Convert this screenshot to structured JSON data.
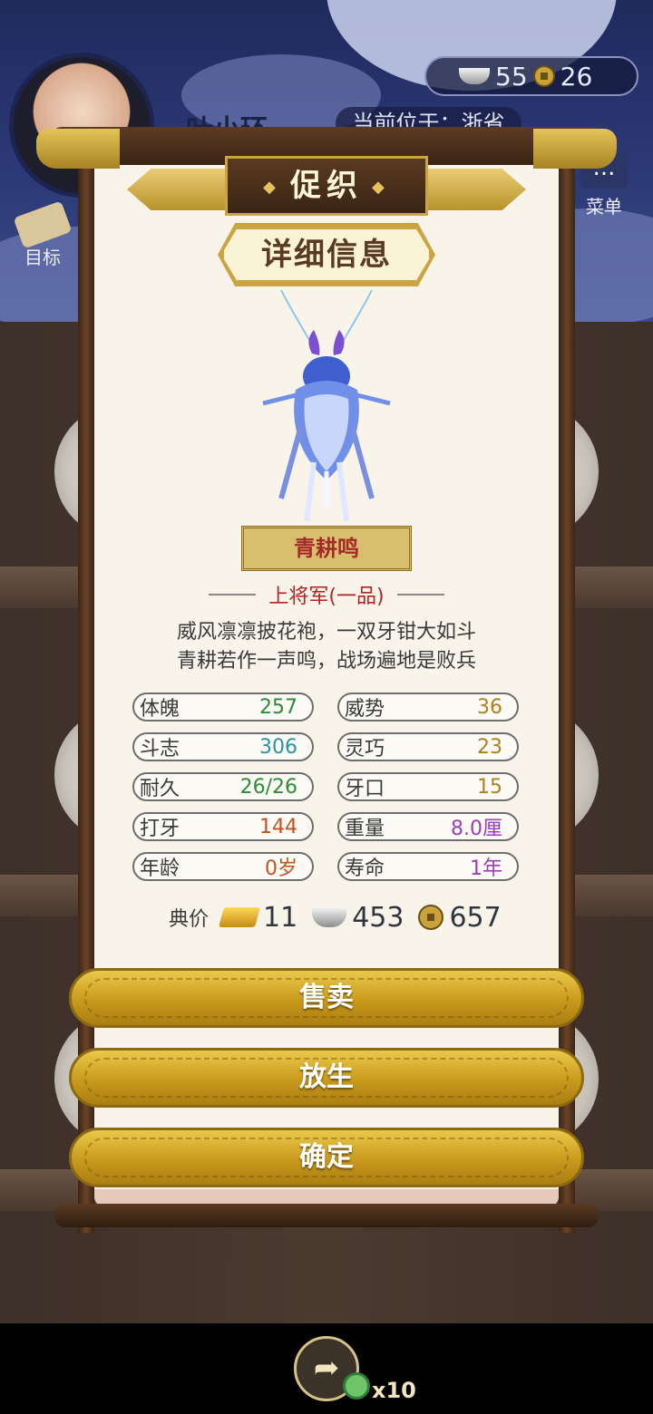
{
  "header": {
    "player_name": "叶小环",
    "location": "当前位于：浙省",
    "currency_silver": "55",
    "currency_copper": "26",
    "goal_label": "目标",
    "menu_label": "菜单",
    "menu_icon": "..."
  },
  "panel": {
    "title": "促织",
    "title_deco": "◆",
    "section_header": "详细信息",
    "cricket_name": "青耕鸣",
    "rank": "上将军(一品)",
    "poem_line1": "威风凛凛披花袍，一双牙钳大如斗",
    "poem_line2": "青耕若作一声鸣，战场遍地是败兵",
    "stats": [
      {
        "label": "体魄",
        "value": "257",
        "color": "#2e8b3a"
      },
      {
        "label": "威势",
        "value": "36",
        "color": "#b0801c"
      },
      {
        "label": "斗志",
        "value": "306",
        "color": "#2a93a8"
      },
      {
        "label": "灵巧",
        "value": "23",
        "color": "#b0801c"
      },
      {
        "label": "耐久",
        "value": "26/26",
        "color": "#2e8b3a"
      },
      {
        "label": "牙口",
        "value": "15",
        "color": "#b0801c"
      },
      {
        "label": "打牙",
        "value": "144",
        "color": "#c0531f"
      },
      {
        "label": "重量",
        "value": "8.0厘",
        "color": "#9a3fb6"
      },
      {
        "label": "年龄",
        "value": "0岁",
        "color": "#c0531f"
      },
      {
        "label": "寿命",
        "value": "1年",
        "color": "#9a3fb6"
      }
    ],
    "price_label": "典价",
    "price_gold": "11",
    "price_silver": "453",
    "price_copper": "657"
  },
  "buttons": {
    "sell": "售卖",
    "release": "放生",
    "confirm": "确定"
  },
  "bottom": {
    "share_icon": "➦",
    "share_count": "x10"
  }
}
